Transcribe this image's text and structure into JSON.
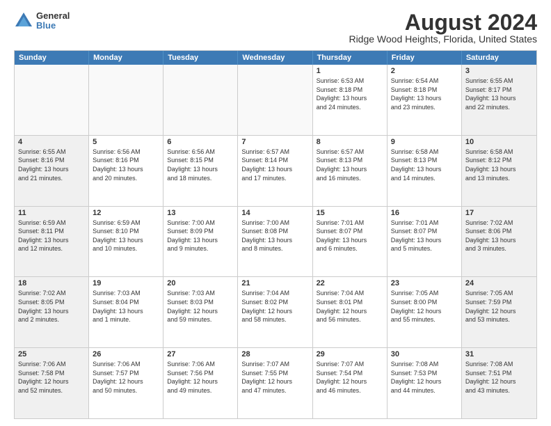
{
  "logo": {
    "general": "General",
    "blue": "Blue"
  },
  "title": "August 2024",
  "subtitle": "Ridge Wood Heights, Florida, United States",
  "days": [
    "Sunday",
    "Monday",
    "Tuesday",
    "Wednesday",
    "Thursday",
    "Friday",
    "Saturday"
  ],
  "rows": [
    [
      {
        "day": "",
        "info": ""
      },
      {
        "day": "",
        "info": ""
      },
      {
        "day": "",
        "info": ""
      },
      {
        "day": "",
        "info": ""
      },
      {
        "day": "1",
        "info": "Sunrise: 6:53 AM\nSunset: 8:18 PM\nDaylight: 13 hours\nand 24 minutes."
      },
      {
        "day": "2",
        "info": "Sunrise: 6:54 AM\nSunset: 8:18 PM\nDaylight: 13 hours\nand 23 minutes."
      },
      {
        "day": "3",
        "info": "Sunrise: 6:55 AM\nSunset: 8:17 PM\nDaylight: 13 hours\nand 22 minutes."
      }
    ],
    [
      {
        "day": "4",
        "info": "Sunrise: 6:55 AM\nSunset: 8:16 PM\nDaylight: 13 hours\nand 21 minutes."
      },
      {
        "day": "5",
        "info": "Sunrise: 6:56 AM\nSunset: 8:16 PM\nDaylight: 13 hours\nand 20 minutes."
      },
      {
        "day": "6",
        "info": "Sunrise: 6:56 AM\nSunset: 8:15 PM\nDaylight: 13 hours\nand 18 minutes."
      },
      {
        "day": "7",
        "info": "Sunrise: 6:57 AM\nSunset: 8:14 PM\nDaylight: 13 hours\nand 17 minutes."
      },
      {
        "day": "8",
        "info": "Sunrise: 6:57 AM\nSunset: 8:13 PM\nDaylight: 13 hours\nand 16 minutes."
      },
      {
        "day": "9",
        "info": "Sunrise: 6:58 AM\nSunset: 8:13 PM\nDaylight: 13 hours\nand 14 minutes."
      },
      {
        "day": "10",
        "info": "Sunrise: 6:58 AM\nSunset: 8:12 PM\nDaylight: 13 hours\nand 13 minutes."
      }
    ],
    [
      {
        "day": "11",
        "info": "Sunrise: 6:59 AM\nSunset: 8:11 PM\nDaylight: 13 hours\nand 12 minutes."
      },
      {
        "day": "12",
        "info": "Sunrise: 6:59 AM\nSunset: 8:10 PM\nDaylight: 13 hours\nand 10 minutes."
      },
      {
        "day": "13",
        "info": "Sunrise: 7:00 AM\nSunset: 8:09 PM\nDaylight: 13 hours\nand 9 minutes."
      },
      {
        "day": "14",
        "info": "Sunrise: 7:00 AM\nSunset: 8:08 PM\nDaylight: 13 hours\nand 8 minutes."
      },
      {
        "day": "15",
        "info": "Sunrise: 7:01 AM\nSunset: 8:07 PM\nDaylight: 13 hours\nand 6 minutes."
      },
      {
        "day": "16",
        "info": "Sunrise: 7:01 AM\nSunset: 8:07 PM\nDaylight: 13 hours\nand 5 minutes."
      },
      {
        "day": "17",
        "info": "Sunrise: 7:02 AM\nSunset: 8:06 PM\nDaylight: 13 hours\nand 3 minutes."
      }
    ],
    [
      {
        "day": "18",
        "info": "Sunrise: 7:02 AM\nSunset: 8:05 PM\nDaylight: 13 hours\nand 2 minutes."
      },
      {
        "day": "19",
        "info": "Sunrise: 7:03 AM\nSunset: 8:04 PM\nDaylight: 13 hours\nand 1 minute."
      },
      {
        "day": "20",
        "info": "Sunrise: 7:03 AM\nSunset: 8:03 PM\nDaylight: 12 hours\nand 59 minutes."
      },
      {
        "day": "21",
        "info": "Sunrise: 7:04 AM\nSunset: 8:02 PM\nDaylight: 12 hours\nand 58 minutes."
      },
      {
        "day": "22",
        "info": "Sunrise: 7:04 AM\nSunset: 8:01 PM\nDaylight: 12 hours\nand 56 minutes."
      },
      {
        "day": "23",
        "info": "Sunrise: 7:05 AM\nSunset: 8:00 PM\nDaylight: 12 hours\nand 55 minutes."
      },
      {
        "day": "24",
        "info": "Sunrise: 7:05 AM\nSunset: 7:59 PM\nDaylight: 12 hours\nand 53 minutes."
      }
    ],
    [
      {
        "day": "25",
        "info": "Sunrise: 7:06 AM\nSunset: 7:58 PM\nDaylight: 12 hours\nand 52 minutes."
      },
      {
        "day": "26",
        "info": "Sunrise: 7:06 AM\nSunset: 7:57 PM\nDaylight: 12 hours\nand 50 minutes."
      },
      {
        "day": "27",
        "info": "Sunrise: 7:06 AM\nSunset: 7:56 PM\nDaylight: 12 hours\nand 49 minutes."
      },
      {
        "day": "28",
        "info": "Sunrise: 7:07 AM\nSunset: 7:55 PM\nDaylight: 12 hours\nand 47 minutes."
      },
      {
        "day": "29",
        "info": "Sunrise: 7:07 AM\nSunset: 7:54 PM\nDaylight: 12 hours\nand 46 minutes."
      },
      {
        "day": "30",
        "info": "Sunrise: 7:08 AM\nSunset: 7:53 PM\nDaylight: 12 hours\nand 44 minutes."
      },
      {
        "day": "31",
        "info": "Sunrise: 7:08 AM\nSunset: 7:51 PM\nDaylight: 12 hours\nand 43 minutes."
      }
    ]
  ]
}
